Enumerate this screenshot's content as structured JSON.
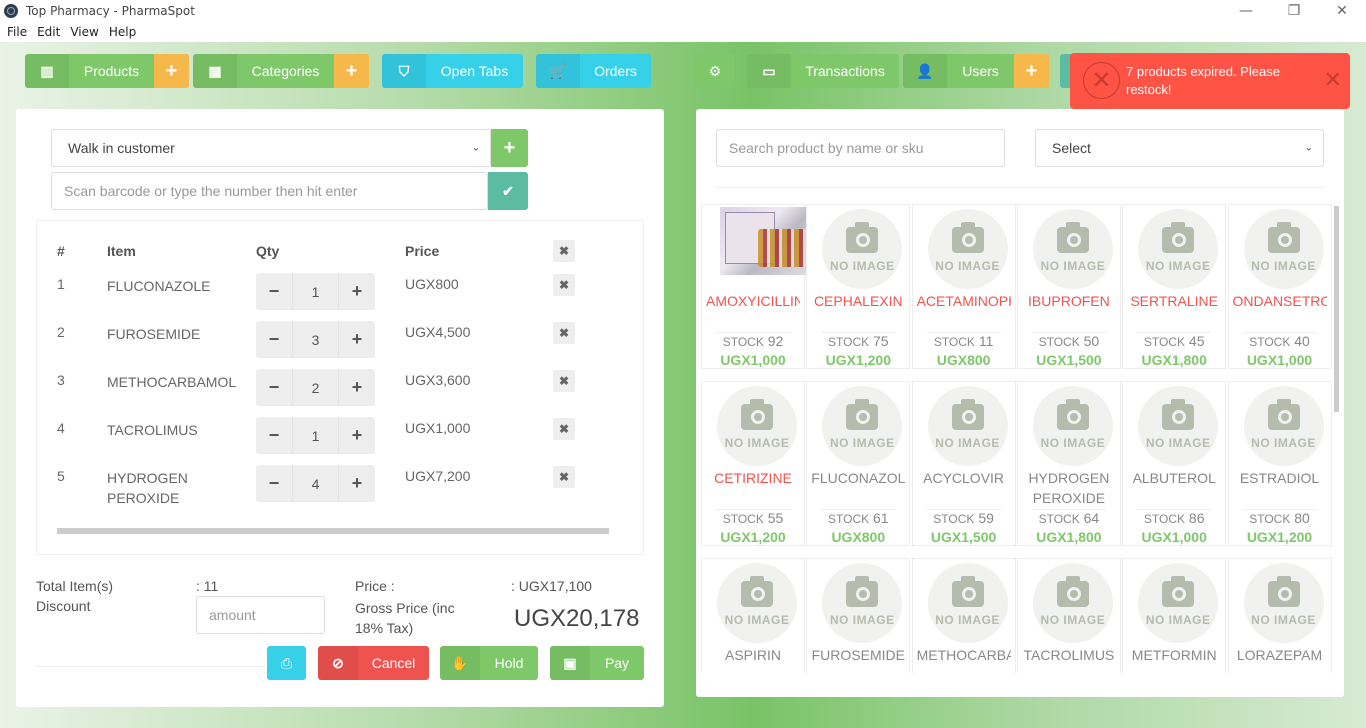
{
  "window": {
    "title": "Top Pharmacy - PharmaSpot",
    "controls": [
      "—",
      "❐",
      "✕"
    ]
  },
  "menu": [
    "File",
    "Edit",
    "View",
    "Help"
  ],
  "nav": {
    "products": "Products",
    "categories": "Categories",
    "open_tabs": "Open Tabs",
    "orders": "Orders",
    "transactions": "Transactions",
    "users": "Users",
    "plus": "+"
  },
  "icons": {
    "products": "▥",
    "categories": "▦",
    "open_tabs": "⛉",
    "orders": "🛒",
    "settings": "⚙",
    "transactions": "▭",
    "users": "👤",
    "check": "✔",
    "remove": "✖",
    "print": "⎙",
    "cancel": "⊘",
    "hold": "✋",
    "pay": "▣",
    "minus": "−",
    "plus": "+",
    "chevron": "⌄",
    "toast_x": "✕"
  },
  "colors": {
    "green": "#7ec86a",
    "cyan": "#36d0e8",
    "orange": "#f7b84b",
    "red": "#ef5350",
    "teal": "#5bbca3",
    "product_red": "#ef5350",
    "product_gray": "#888888"
  },
  "toast": {
    "message": "7 products expired. Please restock!"
  },
  "cart": {
    "customer": "Walk in customer",
    "barcode_placeholder": "Scan barcode or type the number then hit enter",
    "headers": {
      "num": "#",
      "item": "Item",
      "qty": "Qty",
      "price": "Price"
    },
    "rows": [
      {
        "num": "1",
        "item": "FLUCONAZOLE",
        "qty": "1",
        "price": "UGX800"
      },
      {
        "num": "2",
        "item": "FUROSEMIDE",
        "qty": "3",
        "price": "UGX4,500"
      },
      {
        "num": "3",
        "item": "METHOCARBAMOL",
        "qty": "2",
        "price": "UGX3,600"
      },
      {
        "num": "4",
        "item": "TACROLIMUS",
        "qty": "1",
        "price": "UGX1,000"
      },
      {
        "num": "5",
        "item": "HYDROGEN PEROXIDE",
        "qty": "4",
        "price": "UGX7,200"
      }
    ]
  },
  "summary": {
    "total_items_label": "Total Item(s)",
    "total_items_value": ": 11",
    "discount_label": "Discount",
    "discount_placeholder": "amount",
    "price_label": "Price :",
    "price_value": ": UGX17,100",
    "gross_label": "Gross Price (inc 18% Tax)",
    "gross_value": "UGX20,178"
  },
  "actions": {
    "cancel": "Cancel",
    "hold": "Hold",
    "pay": "Pay"
  },
  "products_panel": {
    "search_placeholder": "Search product by name or sku",
    "category_select": "Select",
    "no_image": "NO IMAGE",
    "stock_label": "STOCK",
    "items": [
      {
        "name": "AMOXYICILLIN",
        "stock": "92",
        "price": "UGX1,000",
        "expired": true,
        "has_image": true
      },
      {
        "name": "CEPHALEXIN",
        "stock": "75",
        "price": "UGX1,200",
        "expired": true
      },
      {
        "name": "ACETAMINOPHEN",
        "stock": "11",
        "price": "UGX800",
        "expired": true
      },
      {
        "name": "IBUPROFEN",
        "stock": "50",
        "price": "UGX1,500",
        "expired": true
      },
      {
        "name": "SERTRALINE",
        "stock": "45",
        "price": "UGX1,800",
        "expired": true
      },
      {
        "name": "ONDANSETRON",
        "stock": "40",
        "price": "UGX1,000",
        "expired": true
      },
      {
        "name": "CETIRIZINE",
        "stock": "55",
        "price": "UGX1,200",
        "expired": true
      },
      {
        "name": "FLUCONAZOLE",
        "stock": "61",
        "price": "UGX800",
        "expired": false
      },
      {
        "name": "ACYCLOVIR",
        "stock": "59",
        "price": "UGX1,500",
        "expired": false
      },
      {
        "name": "HYDROGEN PEROXIDE",
        "stock": "64",
        "price": "UGX1,800",
        "expired": false
      },
      {
        "name": "ALBUTEROL",
        "stock": "86",
        "price": "UGX1,000",
        "expired": false
      },
      {
        "name": "ESTRADIOL",
        "stock": "80",
        "price": "UGX1,200",
        "expired": false
      },
      {
        "name": "ASPIRIN",
        "expired": false
      },
      {
        "name": "FUROSEMIDE",
        "expired": false
      },
      {
        "name": "METHOCARBAMOL",
        "expired": false
      },
      {
        "name": "TACROLIMUS",
        "expired": false
      },
      {
        "name": "METFORMIN",
        "expired": false
      },
      {
        "name": "LORAZEPAM",
        "expired": false
      }
    ]
  }
}
